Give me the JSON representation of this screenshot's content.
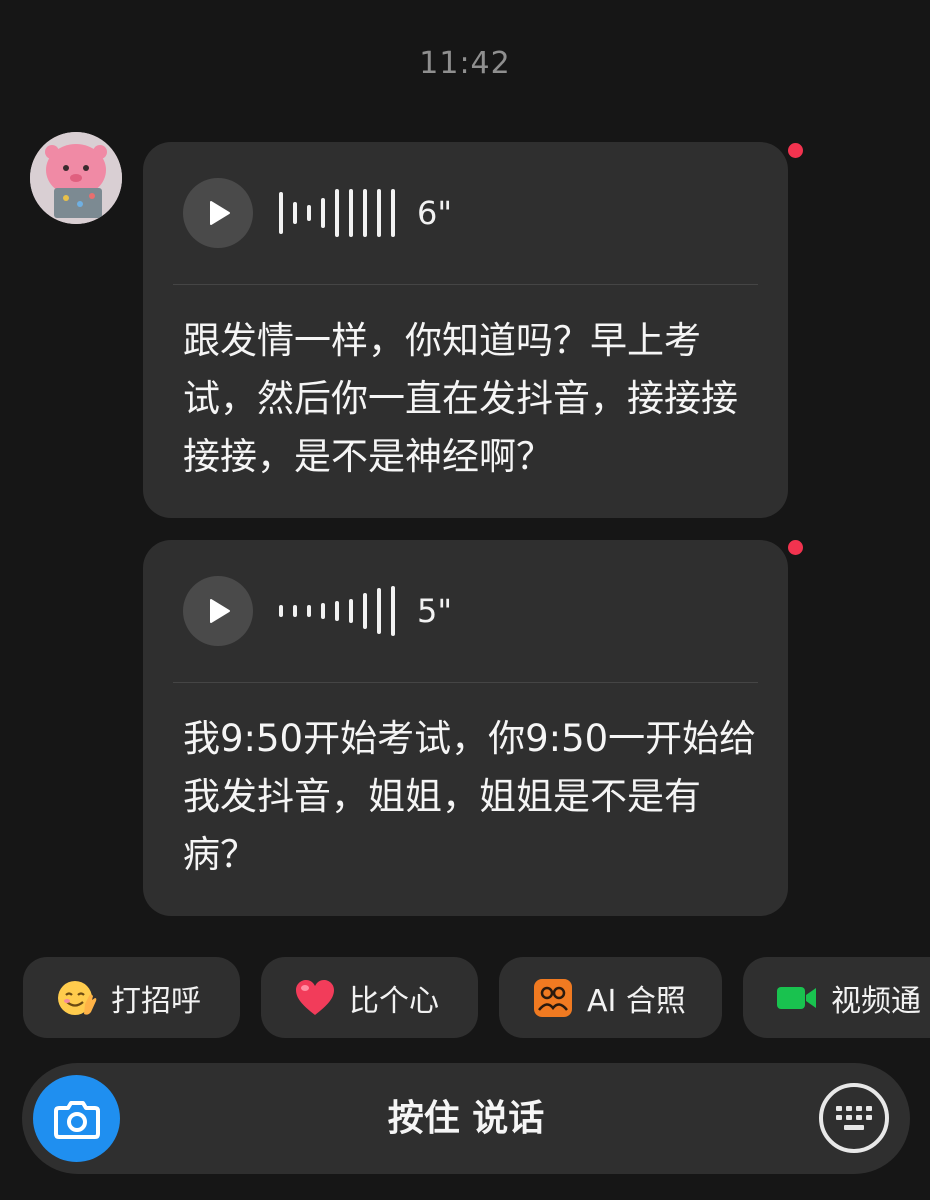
{
  "chat": {
    "timestamp": "11:42",
    "messages": [
      {
        "type": "voice",
        "duration": "6\"",
        "unread": true,
        "transcript": "跟发情一样，你知道吗？早上考试，然后你一直在发抖音，接接接接接，是不是神经啊？"
      },
      {
        "type": "voice",
        "duration": "5\"",
        "unread": true,
        "transcript": "我9:50开始考试，你9:50一开始给我发抖音，姐姐，姐姐是不是有病？"
      }
    ]
  },
  "quick_actions": [
    {
      "label": "打招呼",
      "icon": "wave-emoji-icon"
    },
    {
      "label": "比个心",
      "icon": "heart-icon"
    },
    {
      "label": "AI 合照",
      "icon": "ai-photo-icon"
    },
    {
      "label": "视频通",
      "icon": "video-call-icon"
    }
  ],
  "input_bar": {
    "hold_to_talk_label": "按住 说话",
    "left_icon": "camera-icon",
    "right_icon": "keyboard-icon"
  },
  "colors": {
    "background": "#161616",
    "bubble": "#2f2f2f",
    "unread_dot": "#f2334f",
    "camera_button": "#1f8ff0",
    "video_icon": "#19c24f",
    "ai_photo_icon": "#f07a21",
    "heart": "#f23c5a"
  }
}
